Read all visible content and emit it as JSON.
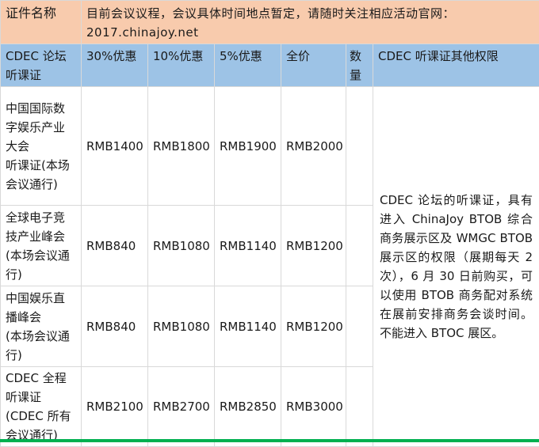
{
  "title_row": {
    "label": "证件名称",
    "text": "目前会议议程，会议具体时间地点暂定，请随时关注相应活动官网：2017.chinajoy.net"
  },
  "header_row": {
    "name": "CDEC 论坛听课证",
    "disc30": "30%优惠",
    "disc10": "10%优惠",
    "disc5": "5%优惠",
    "full": "全价",
    "qty": "数量",
    "rights": "CDEC 听课证其他权限"
  },
  "rows": [
    {
      "name": "中国国际数字娱乐产业大会\n听课证(本场会议通行)",
      "p30": "RMB1400",
      "p10": "RMB1800",
      "p5": "RMB1900",
      "full": "RMB2000"
    },
    {
      "name": "全球电子竞技产业峰会(本场会议通行)",
      "p30": "RMB840",
      "p10": "RMB1080",
      "p5": "RMB1140",
      "full": "RMB1200"
    },
    {
      "name": "中国娱乐直播峰会\n(本场会议通行)",
      "p30": "RMB840",
      "p10": "RMB1080",
      "p5": "RMB1140",
      "full": "RMB1200"
    },
    {
      "name": "CDEC 全程听课证\n(CDEC 所有会议通行)",
      "p30": "RMB2100",
      "p10": "RMB2700",
      "p5": "RMB2850",
      "full": "RMB3000"
    }
  ],
  "rights_text": "CDEC 论坛的听课证，具有进入 ChinaJoy BTOB 综合商务展示区及 WMGC BTOB 展示区的权限（展期每天 2 次），6 月 30 日前购买，可以使用 BTOB 商务配对系统在展前安排商务会谈时间。不能进入 BTOC 展区。",
  "colors": {
    "title_bg": "#f8cbad",
    "header_bg": "#9dc3e6",
    "bottom_bar": "#00b050"
  }
}
